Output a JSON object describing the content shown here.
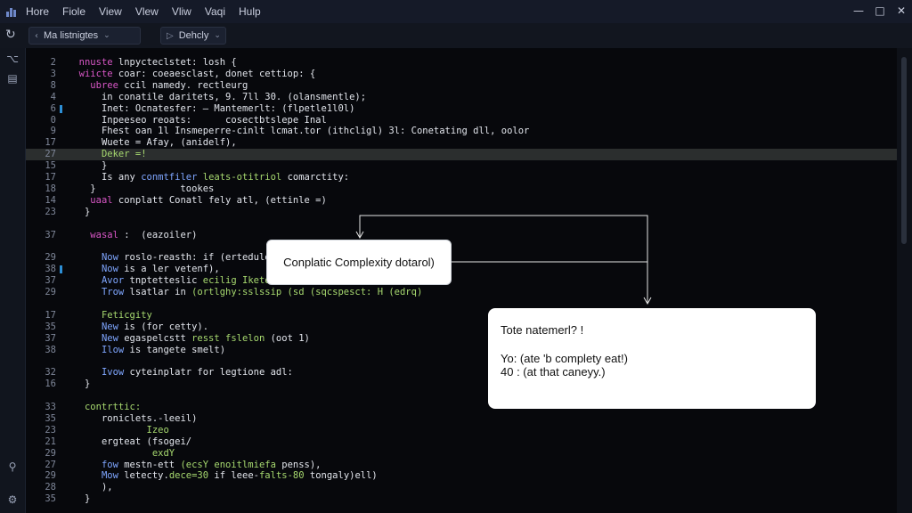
{
  "menu": [
    "Hore",
    "Fiole",
    "View",
    "Vlew",
    "Vliw",
    "Vaqi",
    "Hulp"
  ],
  "window_controls": {
    "minimize": "—",
    "maximize": "□",
    "close": "✕"
  },
  "toolbar": {
    "refresh_icon": "↻",
    "tab1": {
      "lead": "‹",
      "label": "Ma listnigtes",
      "chev": "⌄"
    },
    "tab2": {
      "lead": "▷",
      "label": "Dehcly",
      "chev": "⌄"
    }
  },
  "activity_icons": [
    "code-icon",
    "files-icon",
    "accessibility-icon",
    "settings-icon"
  ],
  "code_lines": [
    {
      "n": "2",
      "segs": [
        {
          "t": "  "
        },
        {
          "t": "nnuste",
          "c": "kw"
        },
        {
          "t": " lnpycteclstet: losh {",
          "c": "tx"
        }
      ]
    },
    {
      "n": "3",
      "segs": [
        {
          "t": "  "
        },
        {
          "t": "wiicte",
          "c": "kw"
        },
        {
          "t": " coar: coeaesclast, donet cettiop: {",
          "c": "tx"
        }
      ]
    },
    {
      "n": "8",
      "segs": [
        {
          "t": "    "
        },
        {
          "t": "ubree",
          "c": "kw"
        },
        {
          "t": " ccil",
          "c": "tx"
        },
        {
          "t": " namedy. rectleurg",
          "c": "tx"
        }
      ]
    },
    {
      "n": "4",
      "segs": [
        {
          "t": "      "
        },
        {
          "t": "in conatile daritets, 9. 7ll 30. (olansmentle);",
          "c": "tx"
        }
      ]
    },
    {
      "n": "6",
      "segs": [
        {
          "t": "      "
        },
        {
          "t": "Inet: Ocnatesfer: — Mantemerlt: (flpetle1l0l)",
          "c": "tx"
        }
      ]
    },
    {
      "n": "0",
      "segs": [
        {
          "t": "      "
        },
        {
          "t": "Inpeeseo reoats:      cosectbtslepe Inal",
          "c": "tx"
        }
      ]
    },
    {
      "n": "9",
      "segs": [
        {
          "t": "      "
        },
        {
          "t": "Fhest oan 1l Insmeperre-cinlt lcmat.tor (ithcligl) 3l: Conetating dll, oolor",
          "c": "tx"
        }
      ]
    },
    {
      "n": "17",
      "segs": [
        {
          "t": "      "
        },
        {
          "t": "Wuete = Afay, (anidelf),",
          "c": "tx"
        }
      ]
    },
    {
      "n": "27",
      "hl": true,
      "segs": [
        {
          "t": "      "
        },
        {
          "t": "Deker =!",
          "c": "st"
        }
      ]
    },
    {
      "n": "15",
      "segs": [
        {
          "t": "      "
        },
        {
          "t": "}",
          "c": "tx"
        }
      ]
    },
    {
      "n": "17",
      "segs": [
        {
          "t": "      "
        },
        {
          "t": "Is any ",
          "c": "tx"
        },
        {
          "t": "conmtfiler",
          "c": "fn"
        },
        {
          "t": " leats-otitriol",
          "c": "st"
        },
        {
          "t": " comarctity:",
          "c": "tx"
        }
      ]
    },
    {
      "n": "18",
      "segs": [
        {
          "t": "    }               tookes",
          "c": "tx"
        }
      ]
    },
    {
      "n": "14",
      "segs": [
        {
          "t": "    "
        },
        {
          "t": "uaal",
          "c": "kw"
        },
        {
          "t": " conplatt ",
          "c": "tx"
        },
        {
          "t": "Conatl fely atl, (ettinle =)",
          "c": "tx"
        }
      ]
    },
    {
      "n": "23",
      "segs": [
        {
          "t": "   }",
          "c": "tx"
        }
      ]
    },
    {
      "n": "",
      "segs": []
    },
    {
      "n": "37",
      "segs": [
        {
          "t": "    "
        },
        {
          "t": "wasal",
          "c": "kw"
        },
        {
          "t": " :  (eazoiler)",
          "c": "tx"
        }
      ]
    },
    {
      "n": "",
      "segs": []
    },
    {
      "n": "29",
      "segs": [
        {
          "t": "      "
        },
        {
          "t": "Now",
          "c": "fn"
        },
        {
          "t": " roslo-reasth: if (ertedule",
          "c": "tx"
        }
      ]
    },
    {
      "n": "38",
      "segs": [
        {
          "t": "      "
        },
        {
          "t": "Now",
          "c": "fn"
        },
        {
          "t": " is a ler vetenf),",
          "c": "tx"
        }
      ]
    },
    {
      "n": "37",
      "segs": [
        {
          "t": "      "
        },
        {
          "t": "Avor",
          "c": "fn"
        },
        {
          "t": " tnptetteslic ",
          "c": "tx"
        },
        {
          "t": "ecilig Iketo",
          "c": "st"
        }
      ]
    },
    {
      "n": "29",
      "segs": [
        {
          "t": "      "
        },
        {
          "t": "Trow",
          "c": "fn"
        },
        {
          "t": " lsatlar in ",
          "c": "tx"
        },
        {
          "t": "(ortlghy:sslssip (sd (sqcspesct: H (edrq)",
          "c": "st"
        }
      ]
    },
    {
      "n": "",
      "segs": []
    },
    {
      "n": "17",
      "segs": [
        {
          "t": "      "
        },
        {
          "t": "Feticgity",
          "c": "st"
        }
      ]
    },
    {
      "n": "35",
      "segs": [
        {
          "t": "      "
        },
        {
          "t": "New",
          "c": "fn"
        },
        {
          "t": " is (for cetty).",
          "c": "tx"
        }
      ]
    },
    {
      "n": "37",
      "segs": [
        {
          "t": "      "
        },
        {
          "t": "New",
          "c": "fn"
        },
        {
          "t": " egaspelcstt ",
          "c": "tx"
        },
        {
          "t": "resst fslelon",
          "c": "st"
        },
        {
          "t": " (oot 1)",
          "c": "tx"
        }
      ]
    },
    {
      "n": "38",
      "segs": [
        {
          "t": "      "
        },
        {
          "t": "Ilow",
          "c": "fn"
        },
        {
          "t": " is tangete smelt)",
          "c": "tx"
        }
      ]
    },
    {
      "n": "",
      "segs": []
    },
    {
      "n": "32",
      "segs": [
        {
          "t": "      "
        },
        {
          "t": "Ivow",
          "c": "fn"
        },
        {
          "t": " cyteinplatr for legtione adl:",
          "c": "tx"
        }
      ]
    },
    {
      "n": "16",
      "segs": [
        {
          "t": "   }",
          "c": "tx"
        }
      ]
    },
    {
      "n": "",
      "segs": []
    },
    {
      "n": "33",
      "segs": [
        {
          "t": "   "
        },
        {
          "t": "contrttic:",
          "c": "st"
        }
      ]
    },
    {
      "n": "35",
      "segs": [
        {
          "t": "      "
        },
        {
          "t": "roniclets.-leeil)",
          "c": "tx"
        }
      ]
    },
    {
      "n": "23",
      "segs": [
        {
          "t": "              "
        },
        {
          "t": "Izeo",
          "c": "st"
        }
      ]
    },
    {
      "n": "21",
      "segs": [
        {
          "t": "      "
        },
        {
          "t": "ergteat (fsogei/",
          "c": "tx"
        }
      ]
    },
    {
      "n": "29",
      "segs": [
        {
          "t": "               "
        },
        {
          "t": "exdY",
          "c": "st"
        }
      ]
    },
    {
      "n": "27",
      "segs": [
        {
          "t": "      "
        },
        {
          "t": "fow",
          "c": "fn"
        },
        {
          "t": " mestn-ett ",
          "c": "tx"
        },
        {
          "t": "(ecsY enoitlmiefa",
          "c": "st"
        },
        {
          "t": " penss),",
          "c": "tx"
        }
      ]
    },
    {
      "n": "29",
      "segs": [
        {
          "t": "      "
        },
        {
          "t": "Mow",
          "c": "fn"
        },
        {
          "t": " letecty.",
          "c": "tx"
        },
        {
          "t": "dece=30",
          "c": "st"
        },
        {
          "t": " if leee-",
          "c": "tx"
        },
        {
          "t": "falts-80",
          "c": "st"
        },
        {
          "t": " tongaly)ell)",
          "c": "tx"
        }
      ]
    },
    {
      "n": "28",
      "segs": [
        {
          "t": "      "
        },
        {
          "t": "),",
          "c": "tx"
        }
      ]
    },
    {
      "n": "35",
      "segs": [
        {
          "t": "   }",
          "c": "tx"
        }
      ]
    }
  ],
  "callout": {
    "text": "Conplatic Complexity dotarol)"
  },
  "note": {
    "heading": "Tote natemerl? !",
    "line1": "Yo: (ate 'b complety eat!)",
    "line2": "40 : (at that caneyy.)"
  }
}
